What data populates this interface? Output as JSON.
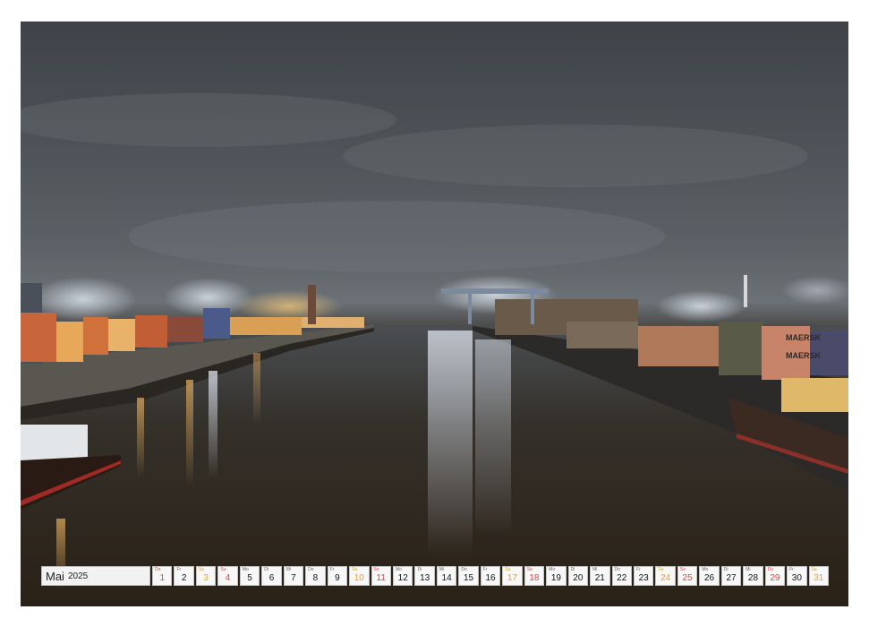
{
  "calendar": {
    "month": "Mai",
    "year": "2025",
    "days": [
      {
        "n": "1",
        "w": "Do",
        "t": "holiday"
      },
      {
        "n": "2",
        "w": "Fr",
        "t": "weekday"
      },
      {
        "n": "3",
        "w": "Sa",
        "t": "sat"
      },
      {
        "n": "4",
        "w": "So",
        "t": "sun"
      },
      {
        "n": "5",
        "w": "Mo",
        "t": "weekday"
      },
      {
        "n": "6",
        "w": "Di",
        "t": "weekday"
      },
      {
        "n": "7",
        "w": "Mi",
        "t": "weekday"
      },
      {
        "n": "8",
        "w": "Do",
        "t": "weekday"
      },
      {
        "n": "9",
        "w": "Fr",
        "t": "weekday"
      },
      {
        "n": "10",
        "w": "Sa",
        "t": "sat"
      },
      {
        "n": "11",
        "w": "So",
        "t": "sun"
      },
      {
        "n": "12",
        "w": "Mo",
        "t": "weekday"
      },
      {
        "n": "13",
        "w": "Di",
        "t": "weekday"
      },
      {
        "n": "14",
        "w": "Mi",
        "t": "weekday"
      },
      {
        "n": "15",
        "w": "Do",
        "t": "weekday"
      },
      {
        "n": "16",
        "w": "Fr",
        "t": "weekday"
      },
      {
        "n": "17",
        "w": "Sa",
        "t": "sat"
      },
      {
        "n": "18",
        "w": "So",
        "t": "sun"
      },
      {
        "n": "19",
        "w": "Mo",
        "t": "weekday"
      },
      {
        "n": "20",
        "w": "Di",
        "t": "weekday"
      },
      {
        "n": "21",
        "w": "Mi",
        "t": "weekday"
      },
      {
        "n": "22",
        "w": "Do",
        "t": "weekday"
      },
      {
        "n": "23",
        "w": "Fr",
        "t": "weekday"
      },
      {
        "n": "24",
        "w": "Sa",
        "t": "sat"
      },
      {
        "n": "25",
        "w": "So",
        "t": "sun"
      },
      {
        "n": "26",
        "w": "Mo",
        "t": "weekday"
      },
      {
        "n": "27",
        "w": "Di",
        "t": "weekday"
      },
      {
        "n": "28",
        "w": "Mi",
        "t": "weekday"
      },
      {
        "n": "29",
        "w": "Do",
        "t": "holiday"
      },
      {
        "n": "30",
        "w": "Fr",
        "t": "weekday"
      },
      {
        "n": "31",
        "w": "Sa",
        "t": "sat"
      }
    ]
  },
  "photo": {
    "container_labels": [
      "MAERSK",
      "MAERSK"
    ]
  }
}
